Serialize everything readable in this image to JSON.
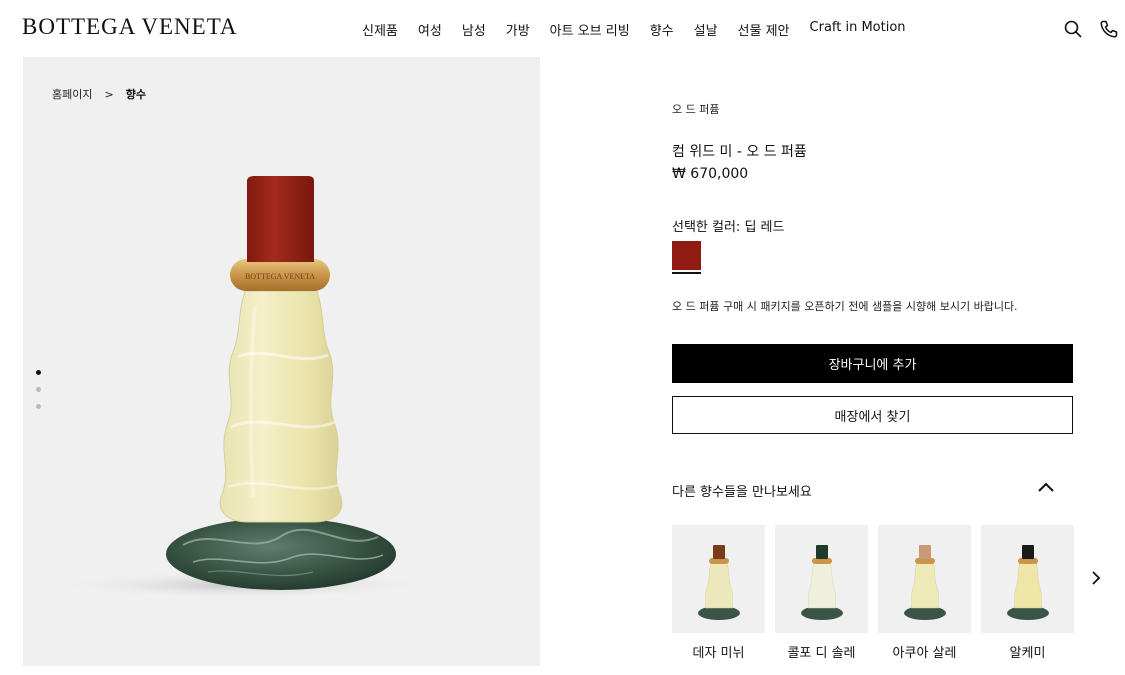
{
  "header": {
    "logo": "BOTTEGA VENETA",
    "nav": [
      "신제품",
      "여성",
      "남성",
      "가방",
      "아트 오브 리빙",
      "향수",
      "설날",
      "선물 제안",
      "Craft in Motion"
    ],
    "icons": [
      "search-icon",
      "phone-icon"
    ]
  },
  "breadcrumb": {
    "home": "홈페이지",
    "separator": ">",
    "current": "향수"
  },
  "gallery": {
    "bottle_label": "BOTTEGA VENETA",
    "image_count": 3,
    "active_image": 1
  },
  "product": {
    "category": "오 드 퍼퓸",
    "title": "컴 위드 미 - 오 드 퍼퓸",
    "price": "₩ 670,000",
    "color_label": "선택한 컬러: 딥 레드",
    "swatch_color": "#8e1c12",
    "notice": "오 드 퍼퓸 구매 시 패키지를 오픈하기 전에 샘플을 시향해 보시기 바랍니다.",
    "add_to_cart": "장바구니에 추가",
    "find_in_store": "매장에서 찾기"
  },
  "related": {
    "heading": "다른 향수들을 만나보세요",
    "items": [
      {
        "name": "데자 미뉘",
        "cap_color": "#7a3a1c"
      },
      {
        "name": "콜포 디 솔레",
        "cap_color": "#1f3a2a"
      },
      {
        "name": "아쿠아 살레",
        "cap_color": "#c89878"
      },
      {
        "name": "알케미",
        "cap_color": "#1a1a1a"
      }
    ]
  }
}
